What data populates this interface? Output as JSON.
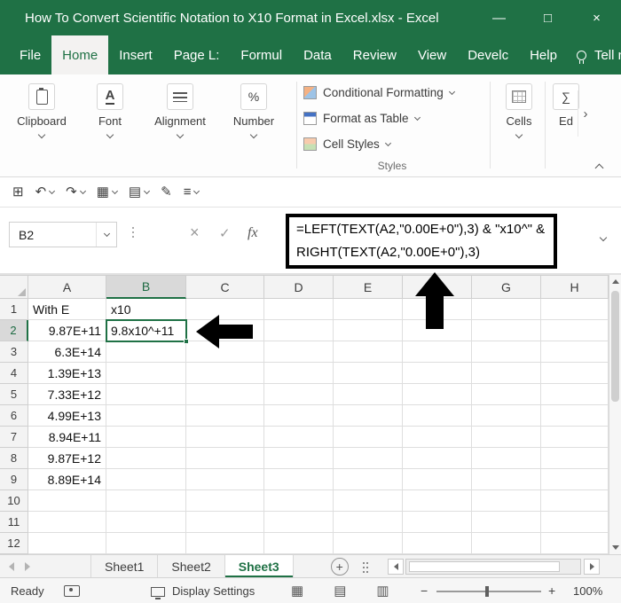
{
  "window": {
    "title": "How To Convert Scientific Notation to X10 Format in Excel.xlsx  -  Excel",
    "controls": {
      "minimize": "—",
      "maximize": "□",
      "close": "×"
    }
  },
  "menu": {
    "tabs": [
      {
        "label": "File",
        "active": false
      },
      {
        "label": "Home",
        "active": true
      },
      {
        "label": "Insert",
        "active": false
      },
      {
        "label": "Page L:",
        "active": false
      },
      {
        "label": "Formul",
        "active": false
      },
      {
        "label": "Data",
        "active": false
      },
      {
        "label": "Review",
        "active": false
      },
      {
        "label": "View",
        "active": false
      },
      {
        "label": "Develc",
        "active": false
      },
      {
        "label": "Help",
        "active": false
      }
    ],
    "tell_me_label": "Tell me"
  },
  "qat": {
    "items": [
      {
        "name": "workbook-icon",
        "glyph": "⊞",
        "caret": false
      },
      {
        "name": "undo-icon",
        "glyph": "↶",
        "caret": true
      },
      {
        "name": "redo-icon",
        "glyph": "↷",
        "caret": true
      },
      {
        "name": "paste-table-icon",
        "glyph": "▦",
        "caret": true
      },
      {
        "name": "format-page-icon",
        "glyph": "▤",
        "caret": true
      },
      {
        "name": "draw-icon",
        "glyph": "✎",
        "caret": false
      },
      {
        "name": "customize-qat-icon",
        "glyph": "≡",
        "caret": true
      }
    ]
  },
  "ribbon": {
    "groups": [
      {
        "label": "Clipboard"
      },
      {
        "label": "Font"
      },
      {
        "label": "Alignment"
      },
      {
        "label": "Number"
      }
    ],
    "font_icon_glyph": "A",
    "number_icon_glyph": "%",
    "styles": {
      "items": [
        "Conditional Formatting",
        "Format as Table",
        "Cell Styles"
      ],
      "group_label": "Styles"
    },
    "cells_label": "Cells",
    "editing_label": "Ed",
    "editing_icon_glyph": "∑",
    "scroll_glyph": "›"
  },
  "formula_bar": {
    "name_box_value": "B2",
    "cancel_glyph": "×",
    "enter_glyph": "✓",
    "fx_label": "fx",
    "formula_line1": "=LEFT(TEXT(A2,\"0.00E+0\"),3) & \"x10^\" &",
    "formula_line2": "RIGHT(TEXT(A2,\"0.00E+0\"),3)"
  },
  "grid": {
    "columns": [
      "A",
      "B",
      "C",
      "D",
      "E",
      "F",
      "G",
      "H"
    ],
    "selected_column": "B",
    "selected_row": "2",
    "selected_cell": "B2",
    "rows": [
      {
        "n": "1",
        "cells": {
          "A": "With E",
          "B": "x10"
        }
      },
      {
        "n": "2",
        "cells": {
          "A": "9.87E+11",
          "B": "9.8x10^+11"
        }
      },
      {
        "n": "3",
        "cells": {
          "A": "6.3E+14"
        }
      },
      {
        "n": "4",
        "cells": {
          "A": "1.39E+13"
        }
      },
      {
        "n": "5",
        "cells": {
          "A": "7.33E+12"
        }
      },
      {
        "n": "6",
        "cells": {
          "A": "4.99E+13"
        }
      },
      {
        "n": "7",
        "cells": {
          "A": "8.94E+11"
        }
      },
      {
        "n": "8",
        "cells": {
          "A": "9.87E+12"
        }
      },
      {
        "n": "9",
        "cells": {
          "A": "8.89E+14"
        }
      },
      {
        "n": "10",
        "cells": {}
      },
      {
        "n": "11",
        "cells": {}
      },
      {
        "n": "12",
        "cells": {}
      }
    ]
  },
  "sheets": {
    "tabs": [
      {
        "label": "Sheet1",
        "active": false
      },
      {
        "label": "Sheet2",
        "active": false
      },
      {
        "label": "Sheet3",
        "active": true
      }
    ],
    "add_glyph": "+"
  },
  "status_bar": {
    "mode": "Ready",
    "display_settings": "Display Settings",
    "view_icons": [
      {
        "name": "normal-view-icon",
        "glyph": "▦"
      },
      {
        "name": "page-layout-view-icon",
        "glyph": "▤"
      },
      {
        "name": "page-break-view-icon",
        "glyph": "▥"
      }
    ],
    "zoom_out": "−",
    "zoom_in": "+",
    "zoom": "100%"
  },
  "colors": {
    "excel_green": "#1f7145",
    "annotation": "#000000",
    "grid_line": "#dedede"
  }
}
